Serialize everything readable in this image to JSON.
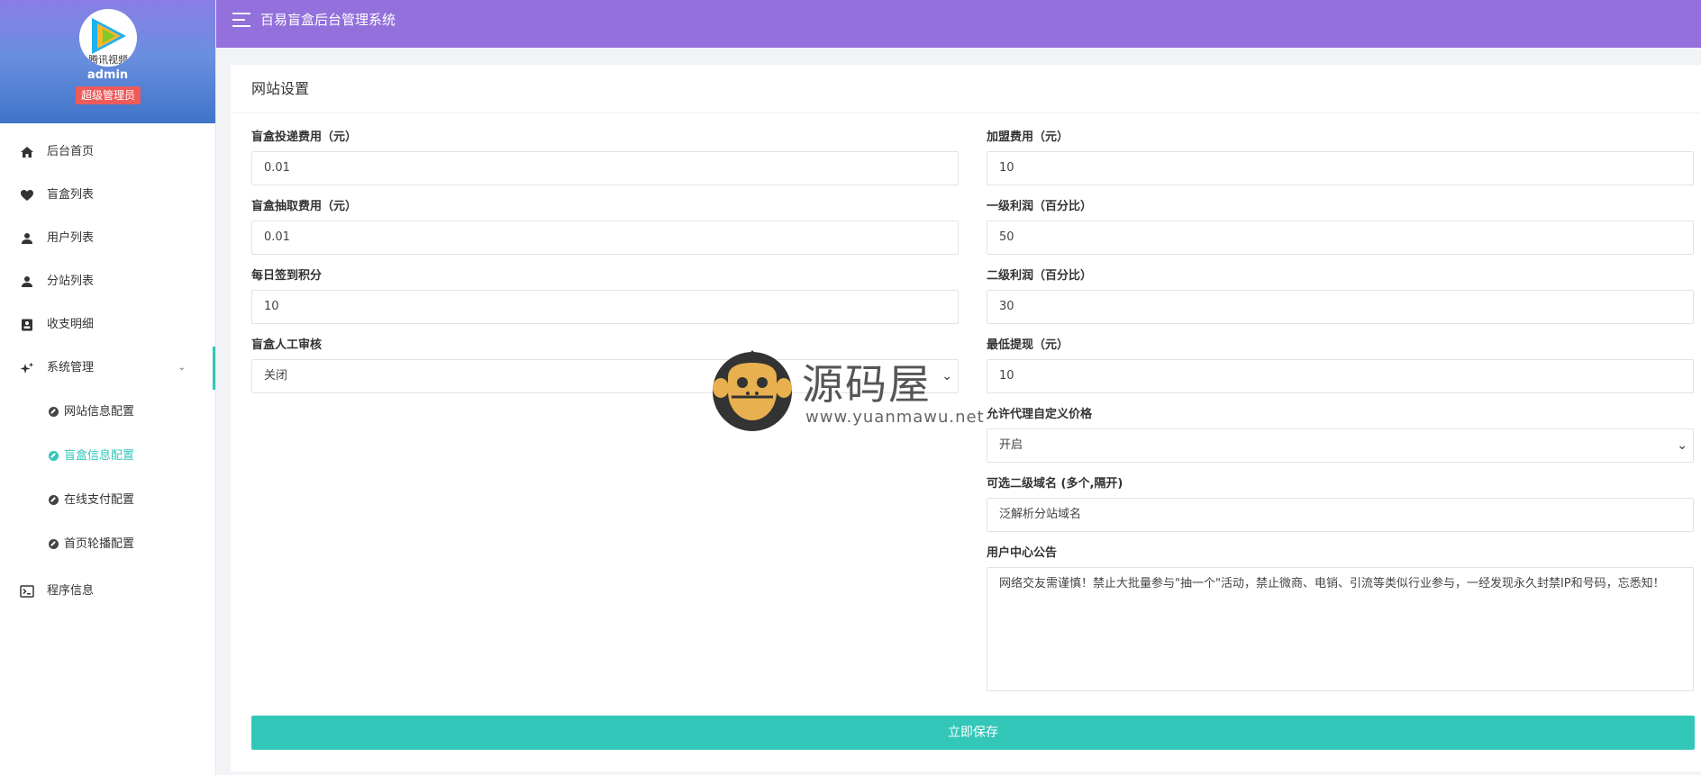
{
  "app": {
    "title": "百易盲盒后台管理系统"
  },
  "user": {
    "name": "admin",
    "role": "超级管理员",
    "avatar_text": "腾讯视频"
  },
  "sidebar": {
    "items": [
      {
        "label": "后台首页",
        "icon": "home-icon"
      },
      {
        "label": "盲盒列表",
        "icon": "heart-icon"
      },
      {
        "label": "用户列表",
        "icon": "user-icon"
      },
      {
        "label": "分站列表",
        "icon": "user-icon"
      },
      {
        "label": "收支明细",
        "icon": "ledger-icon"
      },
      {
        "label": "系统管理",
        "icon": "sparkle-icon"
      }
    ],
    "chevron": "⌄",
    "sub_items": [
      {
        "label": "网站信息配置"
      },
      {
        "label": "盲盒信息配置"
      },
      {
        "label": "在线支付配置"
      },
      {
        "label": "首页轮播配置"
      }
    ],
    "extra": {
      "label": "程序信息",
      "icon": "terminal-icon"
    }
  },
  "card": {
    "title": "网站设置"
  },
  "form": {
    "left": [
      {
        "label": "盲盒投递费用（元）",
        "value": "0.01"
      },
      {
        "label": "盲盒抽取费用（元）",
        "value": "0.01"
      },
      {
        "label": "每日签到积分",
        "value": "10"
      },
      {
        "label": "盲盒人工审核",
        "value": "关闭"
      }
    ],
    "right": [
      {
        "label": "加盟费用（元）",
        "value": "10"
      },
      {
        "label": "一级利润（百分比）",
        "value": "50"
      },
      {
        "label": "二级利润（百分比）",
        "value": "30"
      },
      {
        "label": "最低提现（元）",
        "value": "10"
      },
      {
        "label": "允许代理自定义价格",
        "value": "开启"
      },
      {
        "label": "可选二级域名 (多个,隔开)",
        "value": "泛解析分站域名"
      },
      {
        "label": "用户中心公告",
        "value": "网络交友需谨慎！禁止大批量参与\"抽一个\"活动，禁止微商、电销、引流等类似行业参与，一经发现永久封禁IP和号码，忘悉知！"
      }
    ],
    "save_label": "立即保存"
  },
  "watermark": {
    "title": "源码屋",
    "url": "www.yuanmawu.net"
  },
  "colors": {
    "topbar": "#9370db",
    "accent": "#33c7b9",
    "role_badge": "#ef5a5a"
  }
}
